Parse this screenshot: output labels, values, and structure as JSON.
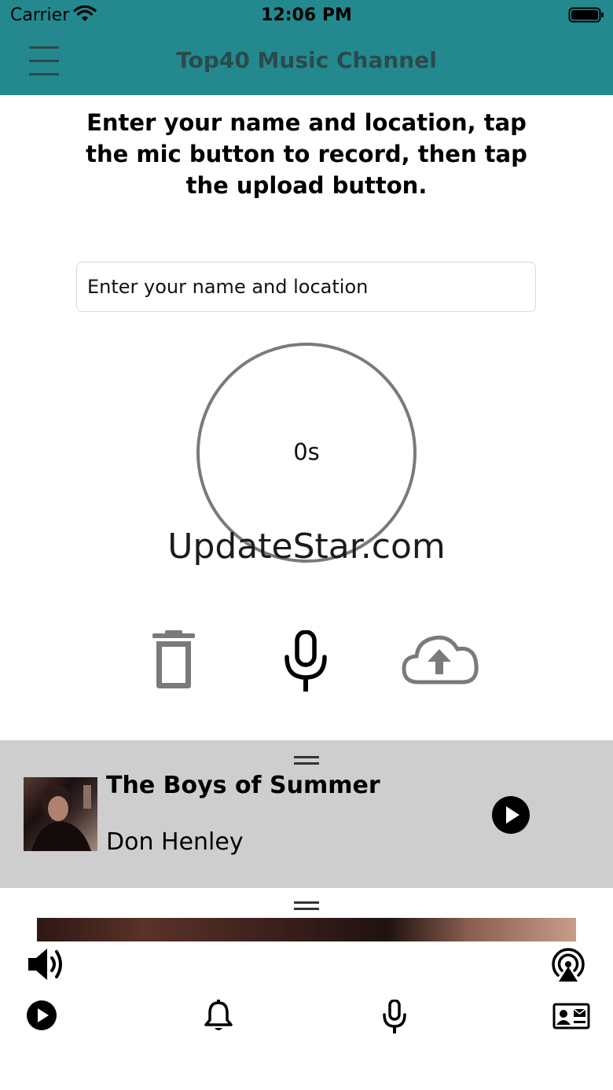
{
  "status_bar": {
    "carrier": "Carrier",
    "time": "12:06 PM",
    "wifi_icon": "wifi-icon",
    "battery_icon": "battery-icon"
  },
  "nav": {
    "title": "Top40 Music Channel",
    "menu_icon": "menu-icon"
  },
  "colors": {
    "header_bg": "#23898e",
    "title_text": "#2b4a4c",
    "mini_player_bg": "#cecece",
    "control_gray": "#7a7a7a"
  },
  "instructions": "Enter your name and location, tap the mic button to record, then tap the upload button.",
  "name_input": {
    "placeholder": "Enter your name and location",
    "value": ""
  },
  "timer": {
    "elapsed": "0s"
  },
  "watermark": "UpdateStar.com",
  "controls": {
    "delete_icon": "trash-icon",
    "record_icon": "mic-icon",
    "upload_icon": "cloud-upload-icon"
  },
  "now_playing": {
    "title": "The Boys of Summer",
    "artist": "Don Henley",
    "play_icon": "play-icon"
  },
  "bottom": {
    "volume_icon": "volume-icon",
    "airplay_icon": "airplay-icon",
    "tabs": [
      {
        "icon": "play-icon"
      },
      {
        "icon": "bell-icon"
      },
      {
        "icon": "mic-icon"
      },
      {
        "icon": "contact-card-icon"
      }
    ]
  }
}
